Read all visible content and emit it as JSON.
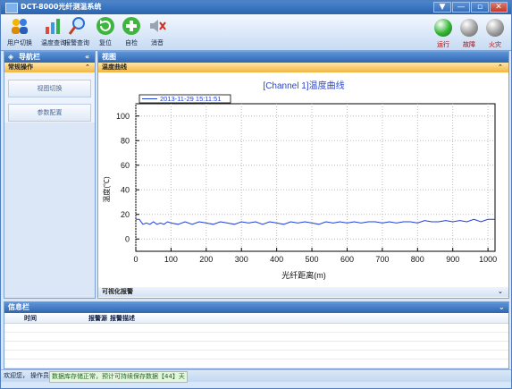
{
  "window": {
    "title": "DCT-8000光纤测温系统",
    "controls": [
      "▼",
      "—",
      "▫",
      "✕"
    ]
  },
  "toolbar": {
    "buttons": [
      {
        "label": "用户切换"
      },
      {
        "label": "温度查询"
      },
      {
        "label": "报警查询"
      },
      {
        "label": "复位"
      },
      {
        "label": "自检"
      },
      {
        "label": "消音"
      }
    ],
    "indicators": [
      {
        "label": "运行",
        "color": "#2fb52f",
        "on": true
      },
      {
        "label": "故障",
        "color": "#9c9c9c",
        "on": false
      },
      {
        "label": "火灾",
        "color": "#9c9c9c",
        "on": false
      }
    ]
  },
  "nav": {
    "header": "导航栏",
    "section": "常规操作",
    "items": [
      "视图切换",
      "参数配置"
    ]
  },
  "main": {
    "header": "视图",
    "subheader": "温度曲线",
    "footer_section": "可视化报警"
  },
  "chart_data": {
    "type": "line",
    "title": "[Channel 1]温度曲线",
    "xlabel": "光纤距离(m)",
    "ylabel": "温度(℃)",
    "xlim": [
      0,
      1020
    ],
    "ylim": [
      -10,
      110
    ],
    "xticks": [
      0,
      100,
      200,
      300,
      400,
      500,
      600,
      700,
      800,
      900,
      1000
    ],
    "yticks": [
      0,
      20,
      40,
      60,
      80,
      100
    ],
    "grid": true,
    "legend_position": "top-left",
    "series": [
      {
        "name": "2013-11-29 15:11:51",
        "color": "#1d3fd8",
        "x": [
          0,
          10,
          20,
          30,
          40,
          50,
          60,
          70,
          80,
          90,
          100,
          120,
          140,
          160,
          180,
          200,
          220,
          240,
          260,
          280,
          300,
          320,
          340,
          360,
          380,
          400,
          420,
          440,
          460,
          480,
          500,
          520,
          540,
          560,
          580,
          600,
          620,
          640,
          660,
          680,
          700,
          720,
          740,
          760,
          780,
          800,
          820,
          840,
          860,
          880,
          900,
          920,
          940,
          960,
          980,
          1000,
          1020
        ],
        "y": [
          16,
          16,
          12,
          13,
          12,
          14,
          12,
          13,
          12,
          14,
          13,
          12,
          14,
          12,
          14,
          13,
          12,
          14,
          13,
          12,
          14,
          13,
          14,
          12,
          14,
          13,
          12,
          14,
          13,
          14,
          13,
          12,
          14,
          13,
          14,
          13,
          14,
          13,
          14,
          14,
          13,
          14,
          13,
          14,
          14,
          13,
          15,
          14,
          14,
          15,
          14,
          15,
          14,
          16,
          14,
          16,
          16
        ]
      }
    ]
  },
  "info": {
    "header": "信息栏",
    "columns": [
      "时间",
      "报警源",
      "报警描述"
    ]
  },
  "status": {
    "welcome": "欢迎您，",
    "user": "操作员",
    "message": "数据库存储正常，预计可持续保存数据【44】天"
  }
}
